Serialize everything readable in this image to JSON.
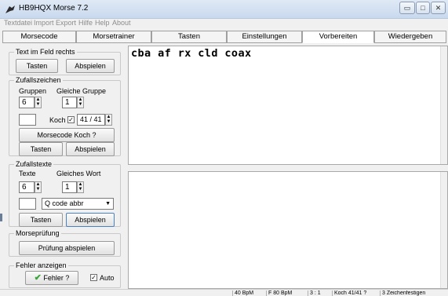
{
  "window": {
    "title": "HB9HQX Morse 7.2",
    "buttons": [
      "minimize",
      "maximize",
      "close"
    ]
  },
  "menu": [
    "Textdatei",
    "Import",
    "Export",
    "Hilfe",
    "Help",
    "About"
  ],
  "tabs": [
    {
      "label": "Morsecode",
      "active": false
    },
    {
      "label": "Morsetrainer",
      "active": false
    },
    {
      "label": "Tasten",
      "active": false
    },
    {
      "label": "Einstellungen",
      "active": false
    },
    {
      "label": "Vorbereiten",
      "active": true
    },
    {
      "label": "Wiedergeben",
      "active": false
    }
  ],
  "text_im_feld": {
    "legend": "Text im Feld rechts",
    "btn_tasten": "Tasten",
    "btn_abspielen": "Abspielen"
  },
  "zufallszeichen": {
    "legend": "Zufallszeichen",
    "gruppen_label": "Gruppen",
    "gleiche_gruppe_label": "Gleiche Gruppe",
    "gruppen_value": "6",
    "gleiche_gruppe_value": "1",
    "koch_label": "Koch",
    "koch_checked": true,
    "koch_value": "41 / 41",
    "btn_koch": "Morsecode Koch ?",
    "btn_tasten": "Tasten",
    "btn_abspielen": "Abspielen"
  },
  "zufallstexte": {
    "legend": "Zufallstexte",
    "texte_label": "Texte",
    "gleiches_wort_label": "Gleiches Wort",
    "texte_value": "6",
    "gleiches_wort_value": "1",
    "dropdown_value": "Q code abbr",
    "btn_tasten": "Tasten",
    "btn_abspielen": "Abspielen"
  },
  "morsepruefung": {
    "legend": "Morseprüfung",
    "btn": "Prüfung abspielen"
  },
  "fehler": {
    "legend": "Fehler anzeigen",
    "btn": "Fehler ?",
    "auto_label": "Auto",
    "auto_checked": true
  },
  "editor_top_text": "cba af rx cld coax",
  "editor_bottom_text": "",
  "status": [
    "40 BpM",
    "F 80 BpM",
    "3 : 1",
    "Koch 41/41 ?",
    "3 Zeichenfestigen"
  ],
  "colors": {
    "check_green": "#3aa33a"
  }
}
